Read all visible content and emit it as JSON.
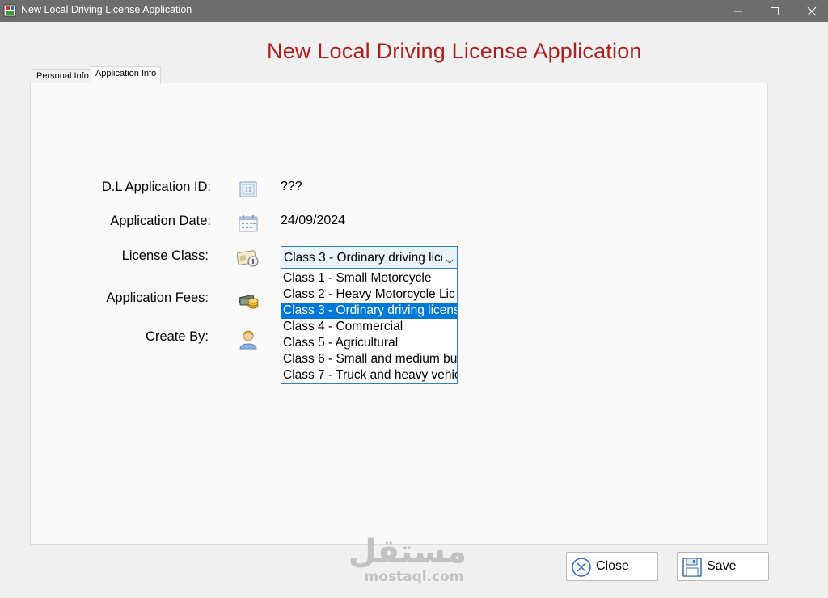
{
  "window": {
    "title": "New Local Driving License Application",
    "minimize_icon": "minimize-icon",
    "maximize_icon": "maximize-icon",
    "close_icon": "close-icon"
  },
  "form": {
    "heading": "New Local Driving License Application",
    "heading_color": "#b01c1c"
  },
  "tabs": [
    {
      "label": "Personal Info",
      "active": false
    },
    {
      "label": "Application Info",
      "active": true
    }
  ],
  "fields": {
    "application_id": {
      "label": "D.L Application ID:",
      "value": "???",
      "icon": "id-card-icon"
    },
    "application_date": {
      "label": "Application Date:",
      "value": "24/09/2024",
      "icon": "calendar-icon"
    },
    "license_class": {
      "label": "License Class:",
      "selected": "Class 3 - Ordinary driving lice",
      "icon": "license-icon"
    },
    "application_fees": {
      "label": "Application Fees:",
      "icon": "money-icon"
    },
    "created_by": {
      "label": "Create By:",
      "icon": "user-icon"
    }
  },
  "license_class_options": [
    "Class 1 - Small Motorcycle",
    "Class 2 - Heavy Motorcycle Lic",
    "Class 3 - Ordinary driving licens",
    "Class 4 - Commercial",
    "Class 5 - Agricultural",
    "Class 6 - Small and medium bu",
    "Class 7 - Truck and heavy vehic"
  ],
  "license_class_selected_index": 2,
  "buttons": {
    "close_label": "Close",
    "save_label": "Save"
  },
  "watermark": {
    "arabic": "مستقل",
    "latin": "mostaql.com"
  },
  "colors": {
    "titlebar": "#6d6d6d",
    "selection": "#0078d7",
    "focus_border": "#2f7fd0"
  }
}
